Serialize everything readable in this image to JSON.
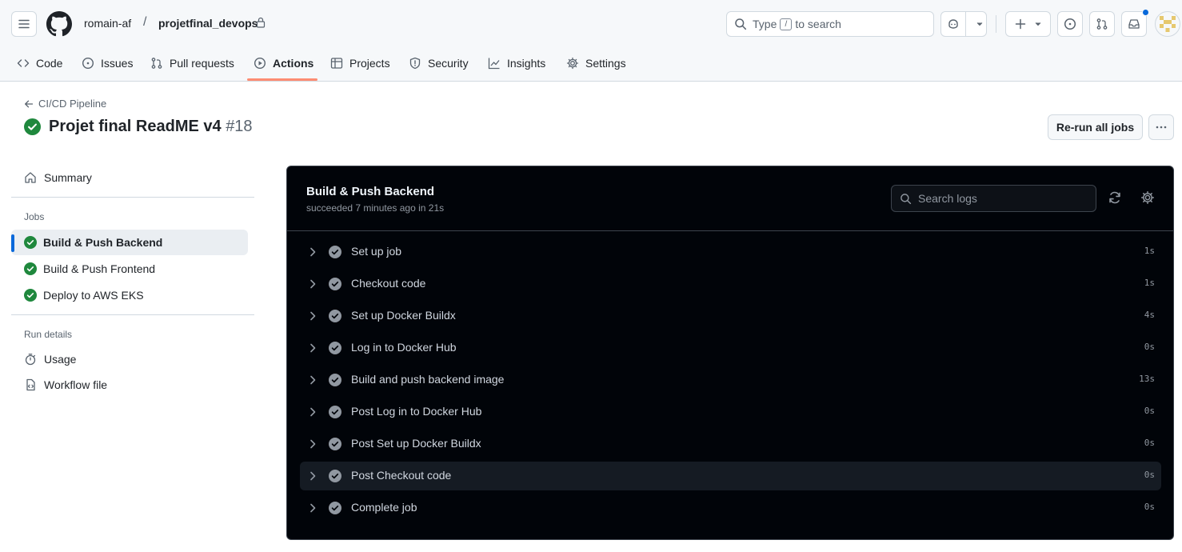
{
  "header": {
    "owner": "romain-af",
    "separator": "/",
    "repo": "projetfinal_devops",
    "search_placeholder_before": "Type",
    "search_key": "/",
    "search_placeholder_after": "to search"
  },
  "tabs": [
    {
      "label": "Code",
      "icon": "code-icon"
    },
    {
      "label": "Issues",
      "icon": "issue-opened-icon"
    },
    {
      "label": "Pull requests",
      "icon": "git-pull-request-icon"
    },
    {
      "label": "Actions",
      "icon": "play-icon",
      "active": true
    },
    {
      "label": "Projects",
      "icon": "table-icon"
    },
    {
      "label": "Security",
      "icon": "shield-icon"
    },
    {
      "label": "Insights",
      "icon": "graph-icon"
    },
    {
      "label": "Settings",
      "icon": "gear-icon"
    }
  ],
  "run": {
    "back_label": "CI/CD Pipeline",
    "title": "Projet final ReadME v4",
    "number": "#18",
    "rerun_label": "Re-run all jobs"
  },
  "sidebar": {
    "summary_label": "Summary",
    "jobs_heading": "Jobs",
    "jobs": [
      {
        "label": "Build & Push Backend",
        "status": "success",
        "selected": true
      },
      {
        "label": "Build & Push Frontend",
        "status": "success"
      },
      {
        "label": "Deploy to AWS EKS",
        "status": "success"
      }
    ],
    "run_details_heading": "Run details",
    "usage_label": "Usage",
    "workflow_file_label": "Workflow file"
  },
  "job_panel": {
    "title": "Build & Push Backend",
    "status": "succeeded 7 minutes ago in 21s",
    "search_placeholder": "Search logs",
    "steps": [
      {
        "name": "Set up job",
        "duration": "1s"
      },
      {
        "name": "Checkout code",
        "duration": "1s"
      },
      {
        "name": "Set up Docker Buildx",
        "duration": "4s"
      },
      {
        "name": "Log in to Docker Hub",
        "duration": "0s"
      },
      {
        "name": "Build and push backend image",
        "duration": "13s"
      },
      {
        "name": "Post Log in to Docker Hub",
        "duration": "0s"
      },
      {
        "name": "Post Set up Docker Buildx",
        "duration": "0s"
      },
      {
        "name": "Post Checkout code",
        "duration": "0s",
        "highlighted": true
      },
      {
        "name": "Complete job",
        "duration": "0s"
      }
    ]
  },
  "colors": {
    "success": "#1f883d",
    "accent": "#0969da",
    "tab_underline": "#fd8c73",
    "panel_bg": "#010409"
  }
}
